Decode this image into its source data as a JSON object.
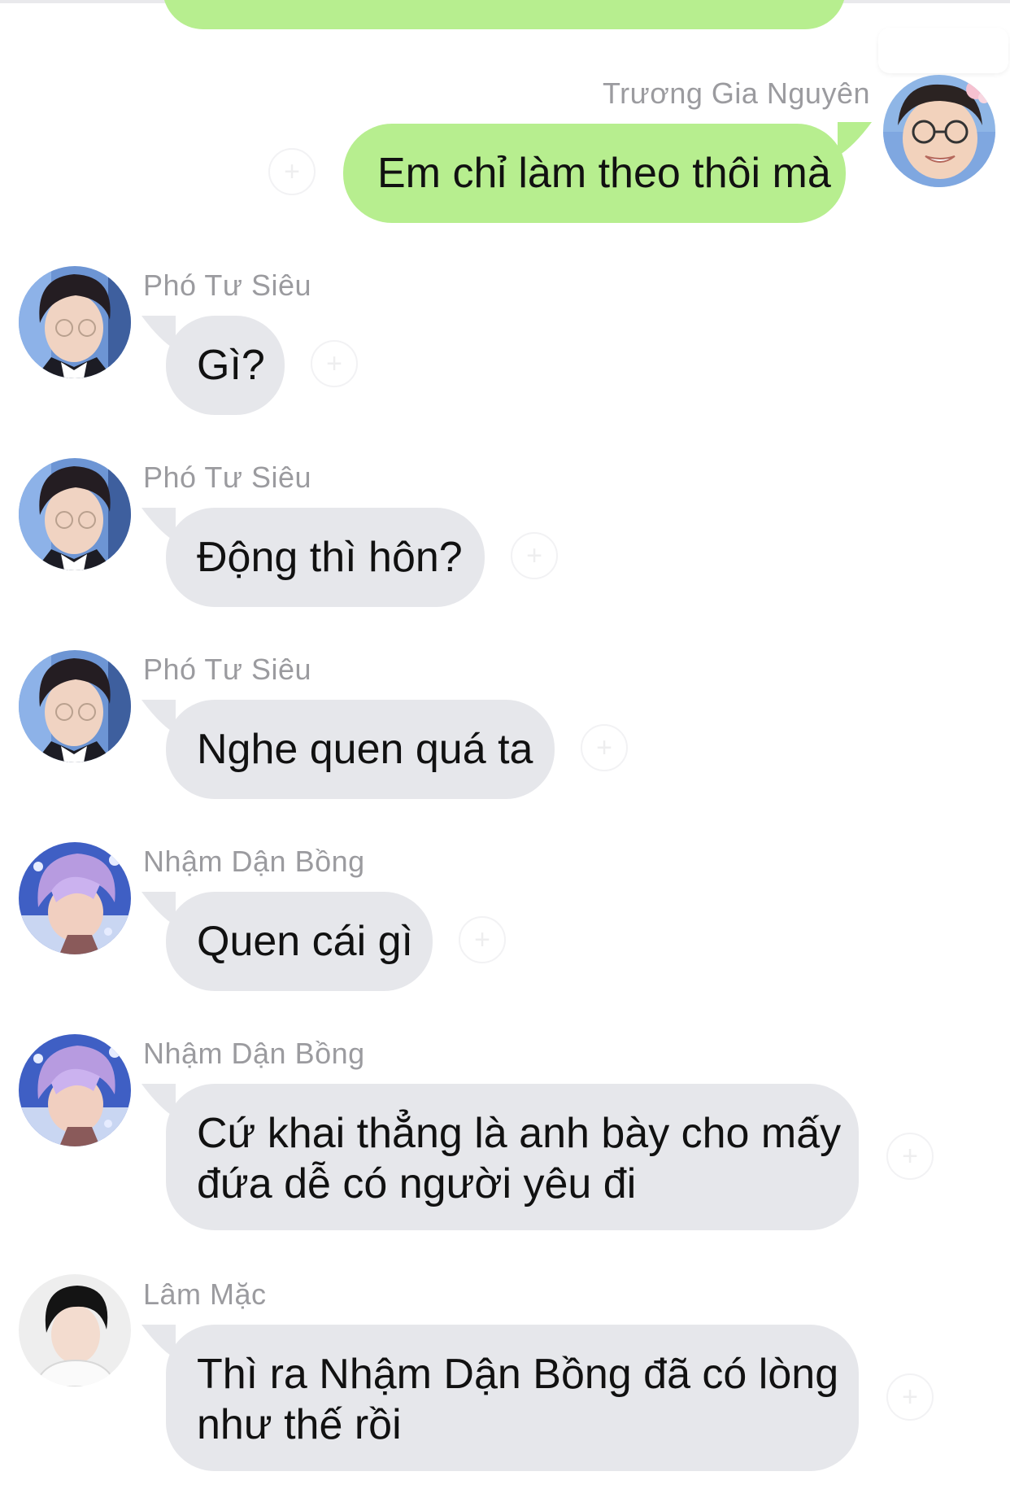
{
  "colors": {
    "sent_bubble": "#b7ee8f",
    "received_bubble": "#e6e7eb",
    "sender_name": "#9b9b9f",
    "background": "#ffffff"
  },
  "messages": [
    {
      "id": "m1",
      "direction": "outgoing",
      "sender": "Trương Gia Nguyên",
      "text": "Em chỉ làm theo thôi mà",
      "avatar_icon": "avatar-truong-gia-nguyen-icon"
    },
    {
      "id": "m2",
      "direction": "incoming",
      "sender": "Phó Tư Siêu",
      "text": "Gì?",
      "avatar_icon": "avatar-pho-tu-sieu-icon"
    },
    {
      "id": "m3",
      "direction": "incoming",
      "sender": "Phó Tư Siêu",
      "text": "Động thì hôn?",
      "avatar_icon": "avatar-pho-tu-sieu-icon"
    },
    {
      "id": "m4",
      "direction": "incoming",
      "sender": "Phó Tư Siêu",
      "text": "Nghe quen quá ta",
      "avatar_icon": "avatar-pho-tu-sieu-icon"
    },
    {
      "id": "m5",
      "direction": "incoming",
      "sender": "Nhậm Dận Bồng",
      "text": "Quen cái gì",
      "avatar_icon": "avatar-nham-dan-bong-icon"
    },
    {
      "id": "m6",
      "direction": "incoming",
      "sender": "Nhậm Dận Bồng",
      "text": "Cứ khai thẳng là anh bày cho mấy\nđứa dễ có người yêu đi",
      "avatar_icon": "avatar-nham-dan-bong-icon"
    },
    {
      "id": "m7",
      "direction": "incoming",
      "sender": "Lâm Mặc",
      "text": "Thì ra Nhậm Dận Bồng đã có lòng\nnhư thế rồi",
      "avatar_icon": "avatar-lam-mac-icon"
    }
  ]
}
